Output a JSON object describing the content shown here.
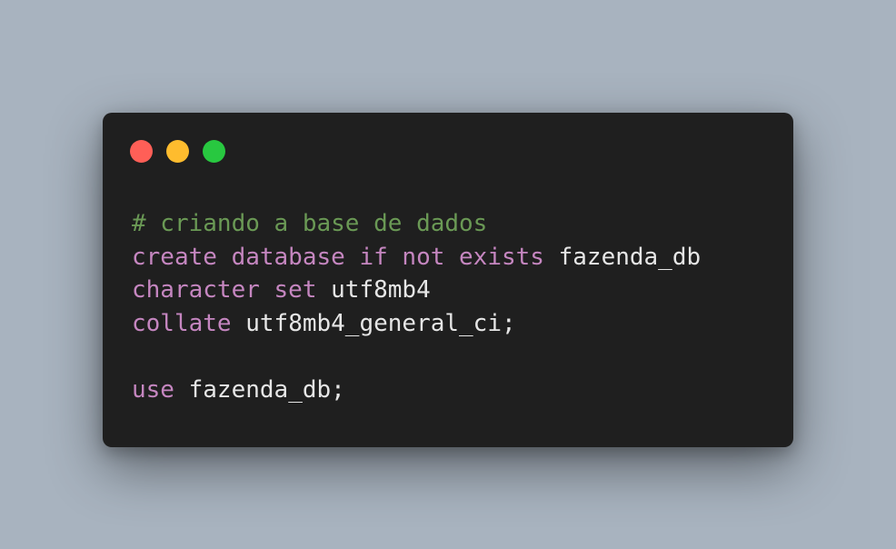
{
  "colors": {
    "background": "#a8b3bf",
    "window": "#1f1f1f",
    "close": "#ff5f57",
    "minimize": "#febc2e",
    "maximize": "#28c840",
    "comment": "#6a9955",
    "keyword": "#c586c0",
    "plain": "#e6e6e6"
  },
  "window_controls": [
    {
      "name": "close-button",
      "icon": "red-circle"
    },
    {
      "name": "minimize-button",
      "icon": "yellow-circle"
    },
    {
      "name": "maximize-button",
      "icon": "green-circle"
    }
  ],
  "code": {
    "lines": [
      [
        {
          "text": "# criando a base de dados",
          "kind": "comment"
        }
      ],
      [
        {
          "text": "create database if not exists",
          "kind": "keyword"
        },
        {
          "text": " fazenda_db",
          "kind": "plain"
        }
      ],
      [
        {
          "text": "character set",
          "kind": "keyword"
        },
        {
          "text": " utf8mb4",
          "kind": "plain"
        }
      ],
      [
        {
          "text": "collate",
          "kind": "keyword"
        },
        {
          "text": " utf8mb4_general_ci;",
          "kind": "plain"
        }
      ],
      [],
      [
        {
          "text": "use",
          "kind": "keyword"
        },
        {
          "text": " fazenda_db;",
          "kind": "plain"
        }
      ]
    ]
  }
}
